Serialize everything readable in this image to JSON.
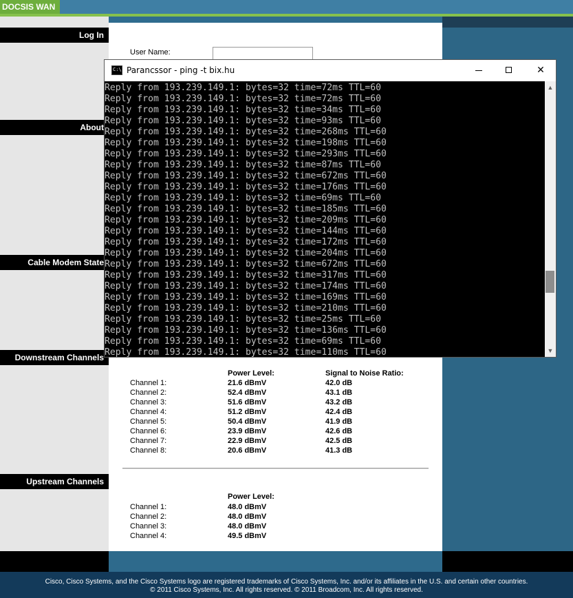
{
  "header": {
    "tab_label": "DOCSIS WAN"
  },
  "nav": {
    "items": [
      "Log In",
      "About",
      "Cable Modem State",
      "Downstream Channels",
      "Upstream Channels"
    ]
  },
  "login": {
    "username_label": "User Name:",
    "username_value": ""
  },
  "downstream": {
    "power_header": "Power Level:",
    "snr_header": "Signal to Noise Ratio:",
    "rows": [
      {
        "channel": "Channel 1:",
        "power": "21.6 dBmV",
        "snr": "42.0 dB"
      },
      {
        "channel": "Channel 2:",
        "power": "52.4 dBmV",
        "snr": "43.1 dB"
      },
      {
        "channel": "Channel 3:",
        "power": "51.6 dBmV",
        "snr": "43.2 dB"
      },
      {
        "channel": "Channel 4:",
        "power": "51.2 dBmV",
        "snr": "42.4 dB"
      },
      {
        "channel": "Channel 5:",
        "power": "50.4 dBmV",
        "snr": "41.9 dB"
      },
      {
        "channel": "Channel 6:",
        "power": "23.9 dBmV",
        "snr": "42.6 dB"
      },
      {
        "channel": "Channel 7:",
        "power": "22.9 dBmV",
        "snr": "42.5 dB"
      },
      {
        "channel": "Channel 8:",
        "power": "20.6 dBmV",
        "snr": "41.3 dB"
      }
    ]
  },
  "upstream": {
    "power_header": "Power Level:",
    "rows": [
      {
        "channel": "Channel 1:",
        "power": "48.0 dBmV"
      },
      {
        "channel": "Channel 2:",
        "power": "48.0 dBmV"
      },
      {
        "channel": "Channel 3:",
        "power": "48.0 dBmV"
      },
      {
        "channel": "Channel 4:",
        "power": "49.5 dBmV"
      }
    ]
  },
  "footer": {
    "line1": "Cisco, Cisco Systems, and the Cisco Systems logo are registered trademarks of Cisco Systems, Inc. and/or its affiliates in the U.S. and certain other countries.",
    "line2": "© 2011 Cisco Systems, Inc. All rights reserved. © 2011 Broadcom, Inc. All rights reserved."
  },
  "console_window": {
    "title": "Parancssor - ping  -t bix.hu",
    "icon_text": "C:\\",
    "icon": "cmd-icon",
    "lines": [
      "Reply from 193.239.149.1: bytes=32 time=72ms TTL=60",
      "Reply from 193.239.149.1: bytes=32 time=72ms TTL=60",
      "Reply from 193.239.149.1: bytes=32 time=34ms TTL=60",
      "Reply from 193.239.149.1: bytes=32 time=93ms TTL=60",
      "Reply from 193.239.149.1: bytes=32 time=268ms TTL=60",
      "Reply from 193.239.149.1: bytes=32 time=198ms TTL=60",
      "Reply from 193.239.149.1: bytes=32 time=293ms TTL=60",
      "Reply from 193.239.149.1: bytes=32 time=87ms TTL=60",
      "Reply from 193.239.149.1: bytes=32 time=672ms TTL=60",
      "Reply from 193.239.149.1: bytes=32 time=176ms TTL=60",
      "Reply from 193.239.149.1: bytes=32 time=69ms TTL=60",
      "Reply from 193.239.149.1: bytes=32 time=185ms TTL=60",
      "Reply from 193.239.149.1: bytes=32 time=209ms TTL=60",
      "Reply from 193.239.149.1: bytes=32 time=144ms TTL=60",
      "Reply from 193.239.149.1: bytes=32 time=172ms TTL=60",
      "Reply from 193.239.149.1: bytes=32 time=204ms TTL=60",
      "Reply from 193.239.149.1: bytes=32 time=672ms TTL=60",
      "Reply from 193.239.149.1: bytes=32 time=317ms TTL=60",
      "Reply from 193.239.149.1: bytes=32 time=174ms TTL=60",
      "Reply from 193.239.149.1: bytes=32 time=169ms TTL=60",
      "Reply from 193.239.149.1: bytes=32 time=210ms TTL=60",
      "Reply from 193.239.149.1: bytes=32 time=25ms TTL=60",
      "Reply from 193.239.149.1: bytes=32 time=136ms TTL=60",
      "Reply from 193.239.149.1: bytes=32 time=69ms TTL=60",
      "Reply from 193.239.149.1: bytes=32 time=110ms TTL=60"
    ]
  },
  "colors": {
    "brand_green": "#6eae3d",
    "brand_blue": "#2e6a8c",
    "console_bg": "#000000",
    "console_text": "#c0c0c0"
  }
}
